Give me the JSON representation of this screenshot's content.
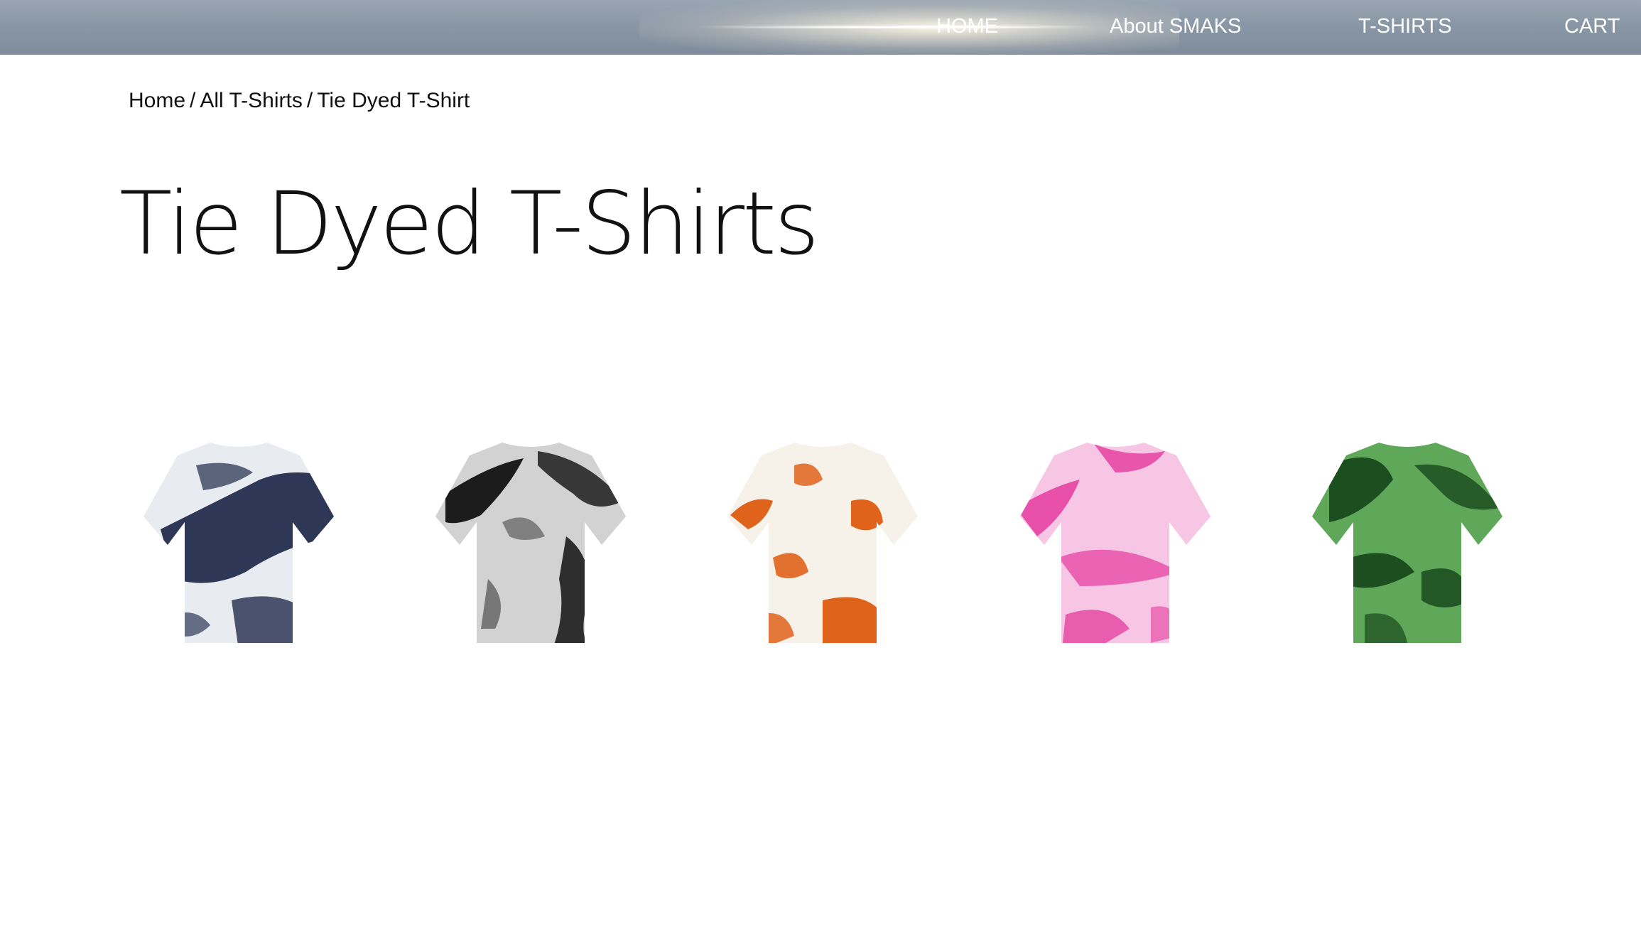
{
  "nav": {
    "home": "HOME",
    "about": "About SMAKS",
    "tshirts": "T-SHIRTS",
    "cart": "CART"
  },
  "breadcrumb": {
    "home": "Home",
    "all": "All T-Shirts",
    "current": "Tie Dyed T-Shirt",
    "separator": "/"
  },
  "page": {
    "title": "Tie Dyed T-Shirts"
  },
  "products": [
    {
      "colorway": "navy-white",
      "base": "#e8ebf0",
      "dye": "#2e3756"
    },
    {
      "colorway": "black-gray",
      "base": "#d2d2d2",
      "dye": "#1c1c1c"
    },
    {
      "colorway": "orange-white",
      "base": "#f6f2ea",
      "dye": "#e0631c"
    },
    {
      "colorway": "pink-white",
      "base": "#f7c6e4",
      "dye": "#e43a9e"
    },
    {
      "colorway": "green",
      "base": "#5fa85a",
      "dye": "#1d4e1f"
    }
  ],
  "colors": {
    "topbar": "#8b98a7",
    "text": "#111111",
    "nav_text": "#ffffff"
  }
}
